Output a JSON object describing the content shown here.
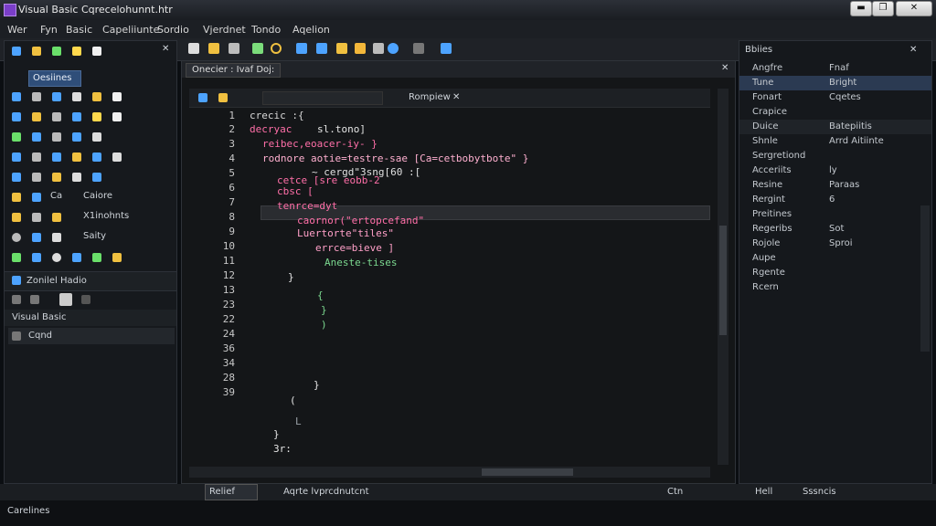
{
  "window": {
    "title": "Visual Basic Cqrecelohunnt.htr",
    "min": "▬",
    "max": "❐",
    "close": "✕"
  },
  "menu": [
    "Wer",
    "Fyn",
    "Basic",
    "Capeliiunte",
    "Sordio",
    "Vjerdnet",
    "Tondo",
    "Aqelion"
  ],
  "toolbox": {
    "header_close": "✕",
    "dropdown_label": "Oesiines",
    "row_labels": [
      "Ca",
      "Caiore",
      "X1inohnts",
      "Saity"
    ],
    "section1": "Zonilel Hadio",
    "section2": "Visual Basic",
    "section3": "Cqnd"
  },
  "editor": {
    "tab_label": "Onecier : Ivaf Doj:",
    "sub_tab": "Rompiew",
    "close": "✕",
    "line_numbers": [
      "1",
      "2",
      "3",
      "4",
      "5",
      "6",
      "7",
      "8",
      "9",
      "10",
      "11",
      "12",
      "13",
      "23",
      "22",
      "24",
      "36",
      "34",
      "28",
      "39"
    ],
    "code": [
      {
        "text": "crecic :{",
        "color": "#d8d8d8"
      },
      {
        "text": "decryac",
        "color": "#ff6fa8"
      },
      {
        "text": "sl.tono]",
        "color": "#e6e6e6"
      },
      {
        "text": "reibec,eoacer-iy- }",
        "color": "#ff6fa8"
      },
      {
        "text": "rodnore aotie=testre-sae [Ca=cetbobytbote\" }",
        "color": "#ffb0d0"
      },
      {
        "text": "~ cergd\"3sng[60 :[",
        "color": "#e0e0e0"
      },
      {
        "text": "cetce [sre eobb-2",
        "color": "#ff6fa8"
      },
      {
        "text": "cbsc [",
        "color": "#ff6fa8"
      },
      {
        "text": "tenrce=dyt",
        "color": "#ff6fa8"
      },
      {
        "text": "caornor(\"ertopcefand\"",
        "color": "#ff6fa8"
      },
      {
        "text": "Luertorte\"tiles\"",
        "color": "#ffa0c8"
      },
      {
        "text": "errce=bieve ]",
        "color": "#ffa0c8"
      },
      {
        "text": "Aneste-tises",
        "color": "#7bd88f"
      },
      {
        "text": "}",
        "color": "#e6e6e6"
      },
      {
        "text": "{",
        "color": "#7bd88f"
      },
      {
        "text": "}",
        "color": "#7bd88f"
      },
      {
        "text": ")",
        "color": "#7bd88f"
      },
      {
        "text": "}",
        "color": "#e6e6e6"
      },
      {
        "text": "(",
        "color": "#e6e6e6"
      },
      {
        "text": "L",
        "color": "#9aa0a6"
      },
      {
        "text": "}",
        "color": "#e6e6e6"
      },
      {
        "text": "3r:",
        "color": "#e6e6e6"
      }
    ]
  },
  "properties": {
    "header": "Bbiies",
    "rows": [
      {
        "key": "Angfre",
        "value": "Fnaf"
      },
      {
        "key": "Tune",
        "value": "Bright"
      },
      {
        "key": "Fonart",
        "value": "Cqetes"
      },
      {
        "key": "Crapice",
        "value": ""
      },
      {
        "key": "Duice",
        "value": "Batepiitis"
      },
      {
        "key": "Shnle",
        "value": "Arrd Aitiinte"
      },
      {
        "key": "Sergretiond",
        "value": ""
      },
      {
        "key": "Acceriits",
        "value": "ly"
      },
      {
        "key": "Resine",
        "value": "Paraas"
      },
      {
        "key": "Rergint",
        "value": "6"
      },
      {
        "key": "Preitines",
        "value": ""
      },
      {
        "key": "Regeribs",
        "value": "Sot"
      },
      {
        "key": "Rojole",
        "value": "Sproi"
      },
      {
        "key": "Aupe",
        "value": ""
      },
      {
        "key": "Rgente",
        "value": ""
      },
      {
        "key": "Rcern",
        "value": ""
      }
    ]
  },
  "status": {
    "left": "Relief",
    "mid": "Aqrte lvprcdnutcnt",
    "search": "Ctn",
    "right1": "Hell",
    "right2": "Sssncis"
  },
  "bottom": {
    "label": "Carelines"
  }
}
